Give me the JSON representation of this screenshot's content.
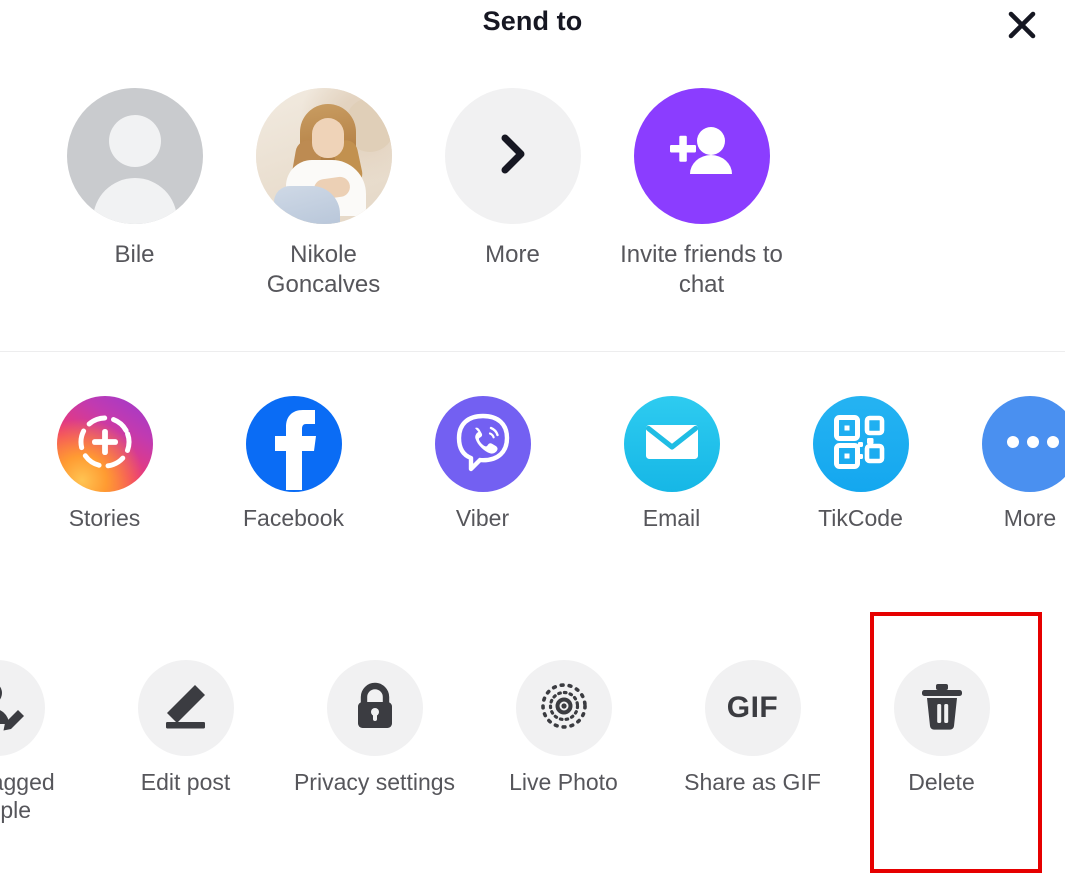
{
  "header": {
    "title": "Send to",
    "close_icon": "close-icon"
  },
  "contacts": {
    "items": [
      {
        "label": "Bile",
        "avatar": "default-person-avatar"
      },
      {
        "label": "Nikole Goncalves",
        "avatar": "photo-avatar"
      },
      {
        "label": "More",
        "icon": "chevron-right-icon"
      },
      {
        "label": "Invite friends to chat",
        "icon": "add-person-icon",
        "color": "#8b3dff"
      }
    ]
  },
  "apps": {
    "items": [
      {
        "label": "Stories",
        "icon": "instagram-stories-icon"
      },
      {
        "label": "Facebook",
        "icon": "facebook-icon",
        "color": "#0a6cf5"
      },
      {
        "label": "Viber",
        "icon": "viber-icon",
        "color": "#7360f2"
      },
      {
        "label": "Email",
        "icon": "envelope-icon",
        "color": "#25c4e8"
      },
      {
        "label": "TikCode",
        "icon": "qr-code-icon",
        "color": "#20b0f0"
      },
      {
        "label": "More",
        "icon": "dots-icon",
        "color": "#4a90f0"
      }
    ]
  },
  "actions": {
    "items": [
      {
        "label": "Edit tagged people",
        "icon": "person-edit-icon"
      },
      {
        "label": "Edit post",
        "icon": "pencil-icon"
      },
      {
        "label": "Privacy settings",
        "icon": "lock-icon"
      },
      {
        "label": "Live Photo",
        "icon": "live-photo-icon"
      },
      {
        "label": "Share as GIF",
        "icon": "gif-icon",
        "icon_text": "GIF"
      },
      {
        "label": "Delete",
        "icon": "trash-icon"
      }
    ]
  },
  "annotation": {
    "highlight_target": "Delete",
    "color": "#e60000"
  }
}
